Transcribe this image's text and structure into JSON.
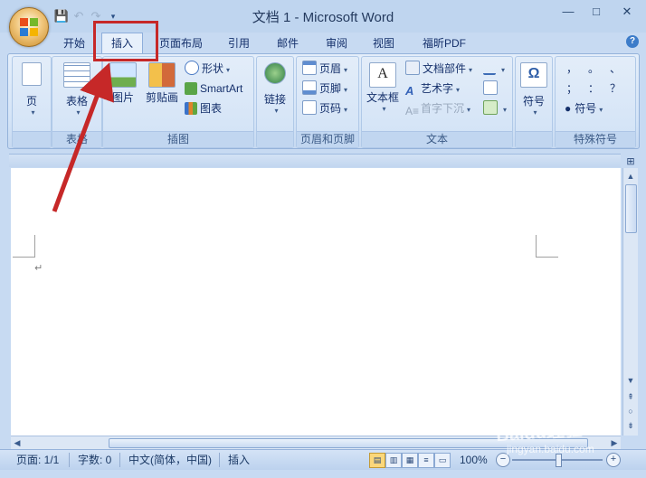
{
  "window": {
    "title": "文档 1 - Microsoft Word"
  },
  "qat": {
    "icons": [
      "save-icon",
      "undo-icon",
      "redo-icon",
      "customize-qat-icon"
    ]
  },
  "window_controls": {
    "minimize": "—",
    "maximize": "□",
    "close": "✕"
  },
  "tabs": [
    {
      "label": "开始",
      "active": false
    },
    {
      "label": "插入",
      "active": true
    },
    {
      "label": "页面布局",
      "active": false
    },
    {
      "label": "引用",
      "active": false
    },
    {
      "label": "邮件",
      "active": false
    },
    {
      "label": "审阅",
      "active": false
    },
    {
      "label": "视图",
      "active": false
    },
    {
      "label": "福昕PDF",
      "active": false
    }
  ],
  "ribbon": {
    "pages": {
      "label": "页",
      "group": ""
    },
    "tables": {
      "label": "表格",
      "group": "表格"
    },
    "illustrations": {
      "group": "插图",
      "picture": "图片",
      "clipart": "剪贴画",
      "shapes": "形状",
      "smartart": "SmartArt",
      "chart": "图表"
    },
    "links": {
      "label": "链接",
      "group": ""
    },
    "header_footer": {
      "group": "页眉和页脚",
      "header": "页眉",
      "footer": "页脚",
      "page_number": "页码"
    },
    "text": {
      "group": "文本",
      "textbox": "文本框",
      "quick_parts": "文档部件",
      "wordart": "艺术字",
      "dropcap": "首字下沉"
    },
    "symbols": {
      "label": "符号",
      "group": ""
    },
    "special": {
      "group": "特殊符号",
      "row1": [
        "，",
        "。",
        "、"
      ],
      "row2": [
        "；",
        "：",
        "？"
      ],
      "symbol_btn": "符号"
    }
  },
  "document": {
    "para_mark": "↵"
  },
  "statusbar": {
    "page": "页面: 1/1",
    "words": "字数: 0",
    "language": "中文(简体，中国)",
    "mode": "插入",
    "zoom": "100%"
  },
  "watermark": {
    "text": "Baidu经验",
    "sub": "jingyan.baidu.com"
  },
  "colors": {
    "highlight": "#c62828",
    "ribbon": "#dbe8f8",
    "frame": "#3f6ca3"
  }
}
